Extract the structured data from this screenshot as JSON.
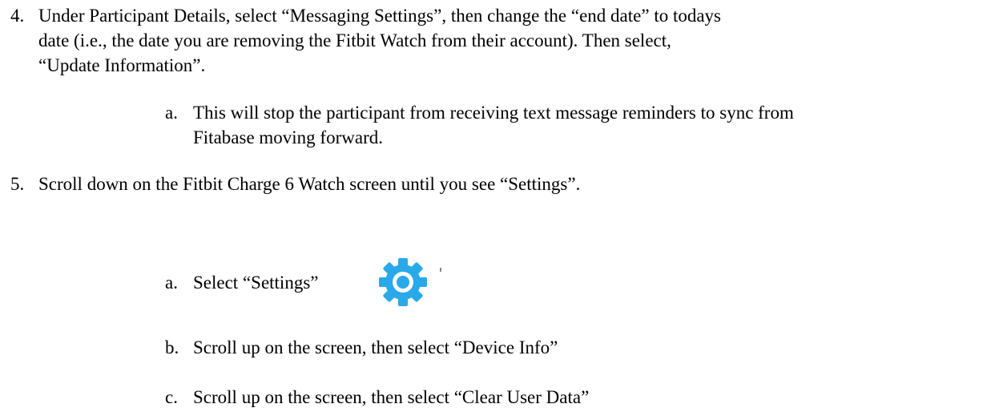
{
  "steps": [
    {
      "number": "4.",
      "lines": [
        "Under Participant Details, select “Messaging Settings”, then change the “end date” to todays",
        "date (i.e., the date you are removing the Fitbit Watch from their account). Then select,",
        "“Update Information”."
      ],
      "substeps": [
        {
          "letter": "a.",
          "lines": [
            "This will stop the participant from receiving text message reminders to sync from",
            "Fitabase moving forward."
          ]
        }
      ]
    },
    {
      "number": "5.",
      "lines": [
        "Scroll down on the Fitbit Charge 6 Watch screen until you see “Settings”."
      ],
      "substeps": [
        {
          "letter": "a.",
          "lines": [
            "Select “Settings”"
          ],
          "icon": "gear-icon"
        },
        {
          "letter": "b.",
          "lines": [
            "Scroll up on the screen, then select “Device Info”"
          ]
        },
        {
          "letter": "c.",
          "lines": [
            "Scroll up on the screen, then select “Clear User Data”"
          ]
        }
      ]
    }
  ],
  "colors": {
    "gear": "#29a9ea",
    "gear_inner": "#ffffff"
  }
}
